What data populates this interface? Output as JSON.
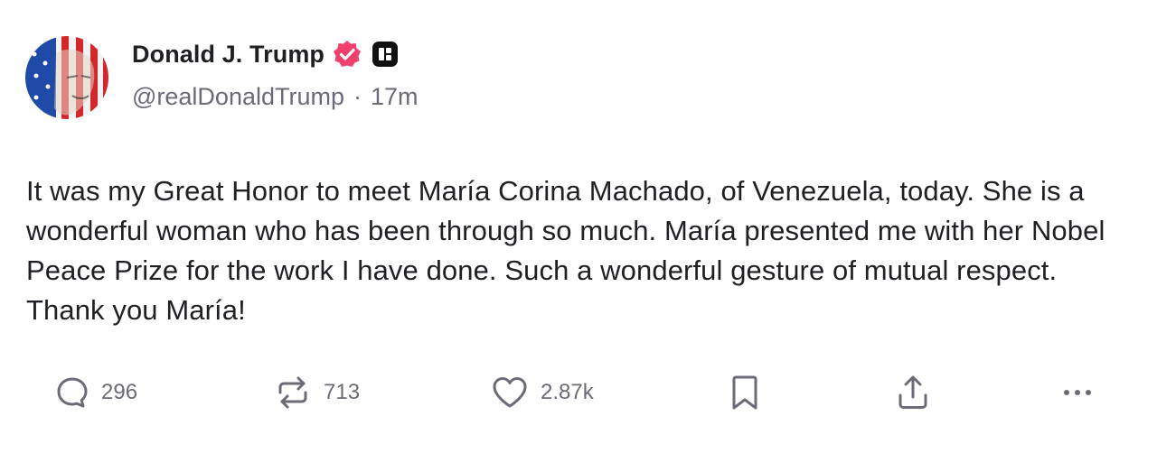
{
  "author": {
    "display_name": "Donald J. Trump",
    "handle": "@realDonaldTrump",
    "separator": "·",
    "time_ago": "17m",
    "verified_color": "#f0406e"
  },
  "post": {
    "text": "It was my Great Honor to meet María Corina Machado, of Venezuela, today. She is a wonderful woman who has been through so much. María presented me with her Nobel Peace Prize for the work I have done. Such a wonderful gesture of mutual respect. Thank you María!"
  },
  "actions": {
    "reply": {
      "icon": "comment-icon",
      "count": "296"
    },
    "repost": {
      "icon": "repost-icon",
      "count": "713"
    },
    "like": {
      "icon": "heart-icon",
      "count": "2.87k"
    },
    "bookmark": {
      "icon": "bookmark-icon"
    },
    "share": {
      "icon": "share-icon"
    },
    "more": {
      "icon": "more-icon"
    }
  }
}
